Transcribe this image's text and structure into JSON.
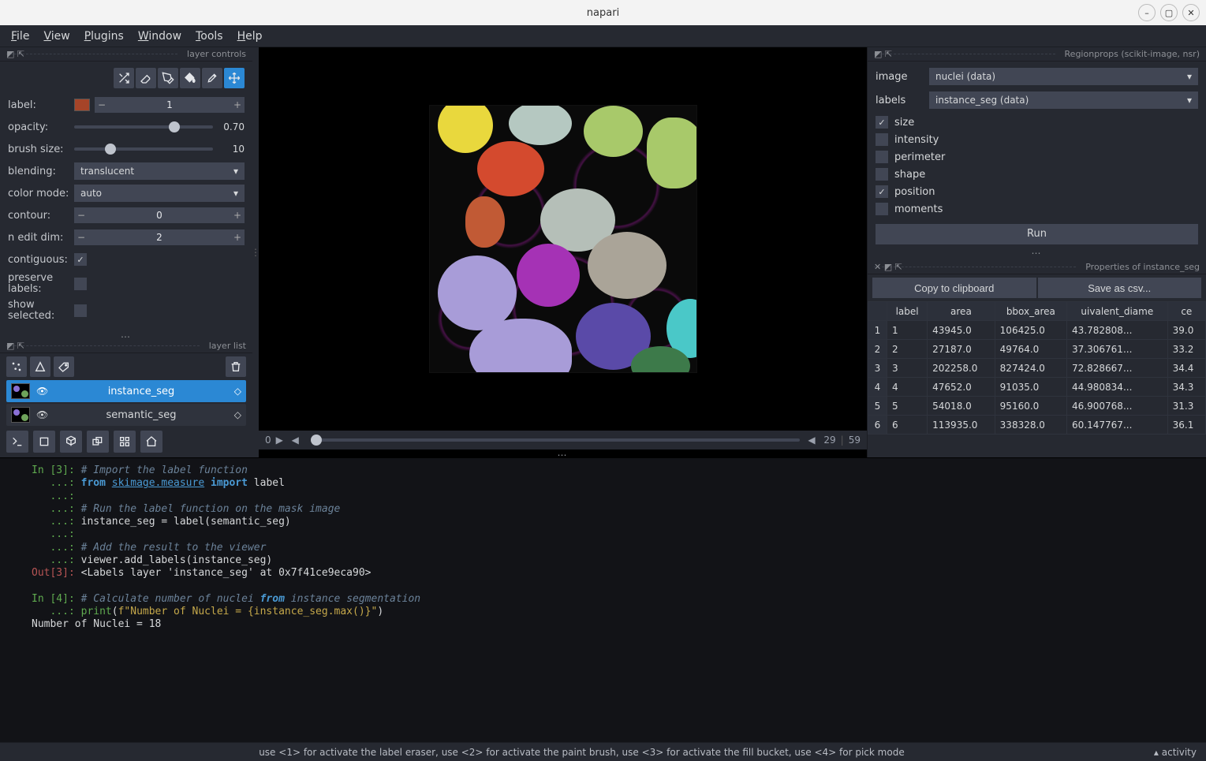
{
  "window": {
    "title": "napari"
  },
  "menubar": [
    "File",
    "View",
    "Plugins",
    "Window",
    "Tools",
    "Help"
  ],
  "dock_titles": {
    "layer_controls": "layer controls",
    "layer_list": "layer list",
    "regionprops": "Regionprops (scikit-image, nsr)",
    "properties": "Properties of instance_seg"
  },
  "layer_controls": {
    "label_label": "label:",
    "label_value": "1",
    "opacity_label": "opacity:",
    "opacity_value": "0.70",
    "brush_label": "brush size:",
    "brush_value": "10",
    "blending_label": "blending:",
    "blending_value": "translucent",
    "colormode_label": "color mode:",
    "colormode_value": "auto",
    "contour_label": "contour:",
    "contour_value": "0",
    "neditdim_label": "n edit dim:",
    "neditdim_value": "2",
    "contiguous_label": "contiguous:",
    "preserve_label": "preserve labels:",
    "show_label": "show selected:"
  },
  "layer_list": {
    "items": [
      {
        "name": "instance_seg",
        "selected": true
      },
      {
        "name": "semantic_seg",
        "selected": false
      }
    ]
  },
  "canvas": {
    "slider_pos": "0",
    "slider_max": "29",
    "slider_total": "59"
  },
  "regionprops": {
    "image_label": "image",
    "image_value": "nuclei (data)",
    "labels_label": "labels",
    "labels_value": "instance_seg (data)",
    "options": [
      {
        "label": "size",
        "checked": true
      },
      {
        "label": "intensity",
        "checked": false
      },
      {
        "label": "perimeter",
        "checked": false
      },
      {
        "label": "shape",
        "checked": false
      },
      {
        "label": "position",
        "checked": true
      },
      {
        "label": "moments",
        "checked": false
      }
    ],
    "run_label": "Run"
  },
  "properties": {
    "copy_label": "Copy to clipboard",
    "save_label": "Save as csv...",
    "columns": [
      "label",
      "area",
      "bbox_area",
      "uivalent_diame",
      "ce"
    ],
    "rows": [
      [
        "1",
        "1",
        "43945.0",
        "106425.0",
        "43.782808...",
        "39.0"
      ],
      [
        "2",
        "2",
        "27187.0",
        "49764.0",
        "37.306761...",
        "33.2"
      ],
      [
        "3",
        "3",
        "202258.0",
        "827424.0",
        "72.828667...",
        "34.4"
      ],
      [
        "4",
        "4",
        "47652.0",
        "91035.0",
        "44.980834...",
        "34.3"
      ],
      [
        "5",
        "5",
        "54018.0",
        "95160.0",
        "46.900768...",
        "31.3"
      ],
      [
        "6",
        "6",
        "113935.0",
        "338328.0",
        "60.147767...",
        "36.1"
      ]
    ]
  },
  "console_text": "In [3]: # Import the label function\n   ...: from skimage.measure import label\n   ...: \n   ...: # Run the label function on the mask image\n   ...: instance_seg = label(semantic_seg)\n   ...: \n   ...: # Add the result to the viewer\n   ...: viewer.add_labels(instance_seg)\nOut[3]: <Labels layer 'instance_seg' at 0x7f41ce9eca90>\n\nIn [4]: # Calculate number of nuclei from instance segmentation\n   ...: print(f\"Number of Nuclei = {instance_seg.max()}\")\nNumber of Nuclei = 18\n",
  "statusbar": {
    "hint": "use <1> for activate the label eraser, use <2> for activate the paint brush, use <3> for activate the fill bucket, use <4> for pick mode",
    "activity": "activity"
  }
}
